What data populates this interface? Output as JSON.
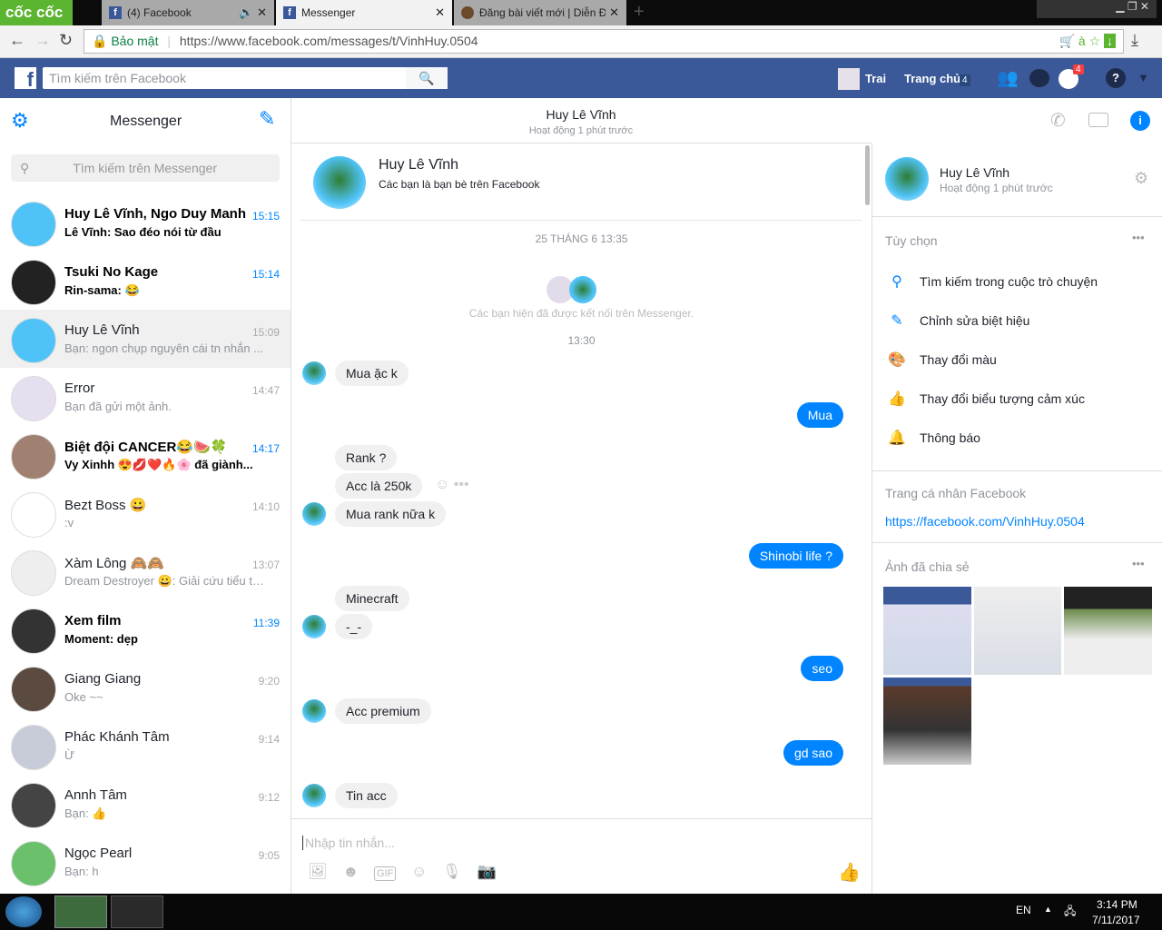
{
  "browser": {
    "logo": "cốc cốc",
    "tabs": [
      {
        "label": "(4) Facebook"
      },
      {
        "label": "Messenger"
      },
      {
        "label": "Đăng bài viết mới | Diễn Đ"
      }
    ],
    "secure_label": "Bảo mật",
    "url": "https://www.facebook.com/messages/t/VinhHuy.0504"
  },
  "fb": {
    "search_placeholder": "Tìm kiếm trên Facebook",
    "user": "Trai",
    "home": "Trang chủ",
    "home_count": "4",
    "notif_count": "4"
  },
  "left": {
    "title": "Messenger",
    "search_placeholder": "Tìm kiếm trên Messenger",
    "conversations": [
      {
        "name": "Huy Lê Vĩnh, Ngo Duy Manh",
        "snippet": "Lê Vĩnh: Sao đéo nói từ đầu",
        "time": "15:15"
      },
      {
        "name": "Tsuki No Kage",
        "snippet": "Rin-sama: 😂",
        "time": "15:14"
      },
      {
        "name": "Huy Lê Vĩnh",
        "snippet": "Bạn: ngon chụp nguyên cái tn nhắn ...",
        "time": "15:09"
      },
      {
        "name": "Error",
        "snippet": "Bạn đã gửi một ảnh.",
        "time": "14:47"
      },
      {
        "name": "Biệt đội CANCER😂🍉🍀",
        "snippet": "Vy Xinhh 😍💋❤️🔥🌸 đã giành...",
        "time": "14:17"
      },
      {
        "name": "Bezt Boss 😀",
        "snippet": ":v",
        "time": "14:10"
      },
      {
        "name": "Xàm Lông 🙈🙈",
        "snippet": "Dream Destroyer 😀: Giải cứu tiểu th...",
        "time": "13:07"
      },
      {
        "name": "Xem film",
        "snippet": "Moment: dẹp",
        "time": "11:39"
      },
      {
        "name": "Giang Giang",
        "snippet": "Oke ~~",
        "time": "9:20"
      },
      {
        "name": "Phác Khánh Tâm",
        "snippet": "Ừ",
        "time": "9:14"
      },
      {
        "name": "Annh Tâm",
        "snippet": "Bạn: 👍",
        "time": "9:12"
      },
      {
        "name": "Ngọc Pearl",
        "snippet": "Bạn: h",
        "time": "9:05"
      }
    ]
  },
  "chat": {
    "name": "Huy Lê Vĩnh",
    "status": "Hoạt động 1 phút trước",
    "intro_name": "Huy Lê Vĩnh",
    "intro_sub": "Các bạn là bạn bè trên Facebook",
    "date": "25 THÁNG 6 13:35",
    "connected": "Các bạn hiện đã được kết nối trên Messenger.",
    "time2": "13:30",
    "messages": [
      "Mua ặc k",
      "Mua",
      "Rank ?",
      "Acc là 250k",
      "Mua rank nữa k",
      "Shinobi life ?",
      "Minecraft",
      "-_-",
      "seo",
      "Acc premium",
      "gd sao",
      "Tin acc"
    ],
    "composer_placeholder": "Nhập tin nhắn...",
    "gif": "GIF"
  },
  "right": {
    "name": "Huy Lê Vĩnh",
    "status": "Hoạt động 1 phút trước",
    "options_title": "Tùy chọn",
    "options": [
      "Tìm kiếm trong cuộc trò chuyện",
      "Chỉnh sửa biệt hiệu",
      "Thay đổi màu",
      "Thay đổi biểu tượng cảm xúc",
      "Thông báo"
    ],
    "profile_title": "Trang cá nhân Facebook",
    "profile_link": "https://facebook.com/VinhHuy.0504",
    "photos_title": "Ảnh đã chia sẻ"
  },
  "taskbar": {
    "lang": "EN",
    "time": "3:14 PM",
    "date": "7/11/2017"
  },
  "colors": {
    "fb_blue": "#3b5998",
    "messenger_blue": "#0084ff"
  }
}
